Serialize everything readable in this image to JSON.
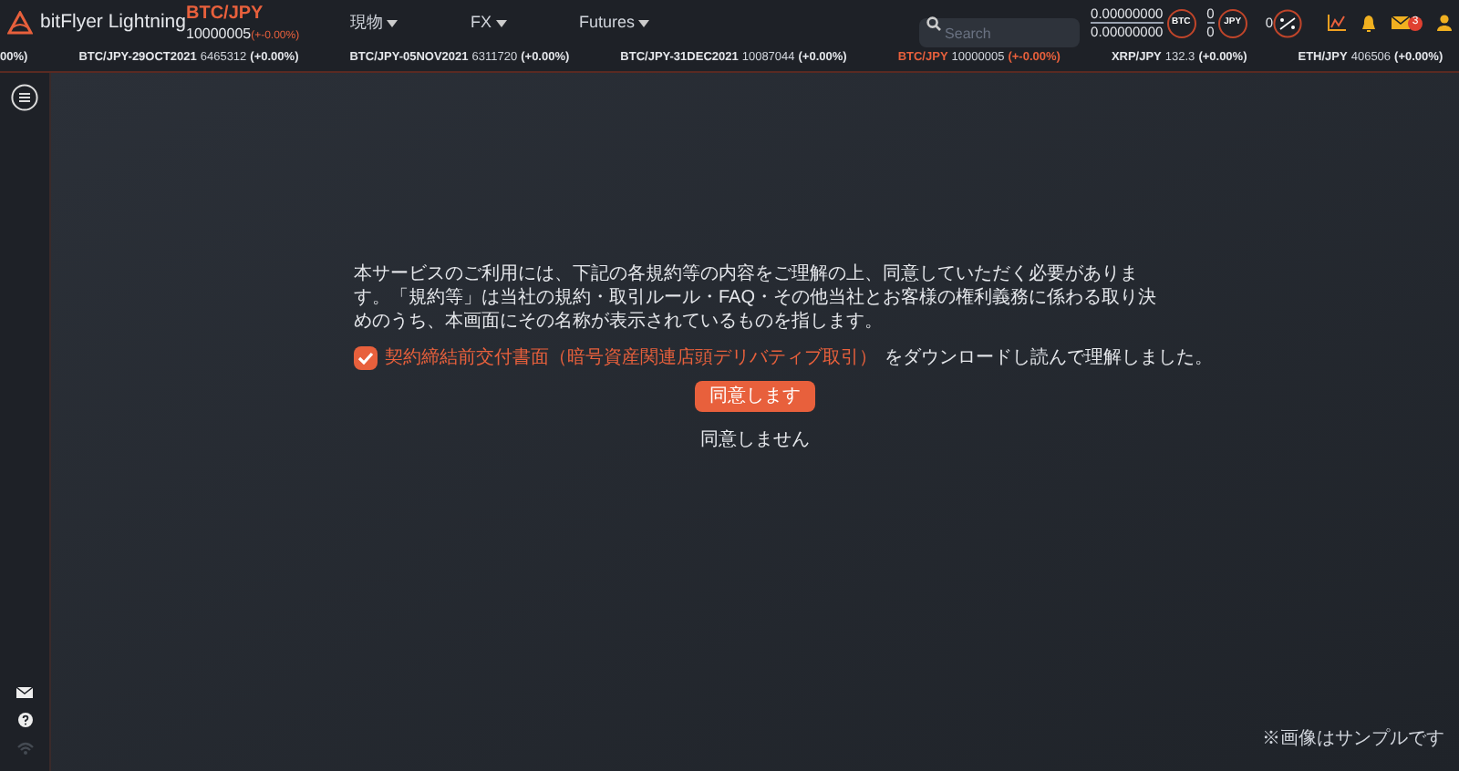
{
  "header": {
    "logo": "bitFlyer Lightning",
    "pair": "BTC/JPY",
    "price": "10000005",
    "change": "(+-0.00%)",
    "menus": [
      "現物",
      "FX",
      "Futures"
    ],
    "search": {
      "placeholder": "Search"
    },
    "btc_balance": [
      "0.00000000",
      "0.00000000"
    ],
    "btc_badge": "BTC",
    "jpy_balance": [
      "0",
      "0"
    ],
    "jpy_badge": "JPY",
    "leverage_value": "0",
    "mail_count": "3"
  },
  "ticker": [
    {
      "kind": "cut",
      "text": "00%)"
    },
    {
      "kind": "item",
      "pair": "BTC/JPY-29OCT2021",
      "price": "6465312",
      "change": "(+0.00%)",
      "selected": false
    },
    {
      "kind": "item",
      "pair": "BTC/JPY-05NOV2021",
      "price": "6311720",
      "change": "(+0.00%)",
      "selected": false
    },
    {
      "kind": "item",
      "pair": "BTC/JPY-31DEC2021",
      "price": "10087044",
      "change": "(+0.00%)",
      "selected": false
    },
    {
      "kind": "item",
      "pair": "BTC/JPY",
      "price": "10000005",
      "change": "(+-0.00%)",
      "selected": true
    },
    {
      "kind": "item",
      "pair": "XRP/JPY",
      "price": "132.3",
      "change": "(+0.00%)",
      "selected": false
    },
    {
      "kind": "item",
      "pair": "ETH/JPY",
      "price": "406506",
      "change": "(+0.00%)",
      "selected": false
    }
  ],
  "agreement": {
    "text": "本サービスのご利用には、下記の各規約等の内容をご理解の上、同意していただく必要があります。「規約等」は当社の規約・取引ルール・FAQ・その他当社とお客様の権利義務に係わる取り決めのうち、本画面にその名称が表示されているものを指します。",
    "checked": true,
    "link": "契約締結前交付書面（暗号資産関連店頭デリバティブ取引）",
    "after_link": "をダウンロードし読んで理解しました。",
    "agree": "同意します",
    "disagree": "同意しません"
  },
  "note": "※画像はサンプルです"
}
